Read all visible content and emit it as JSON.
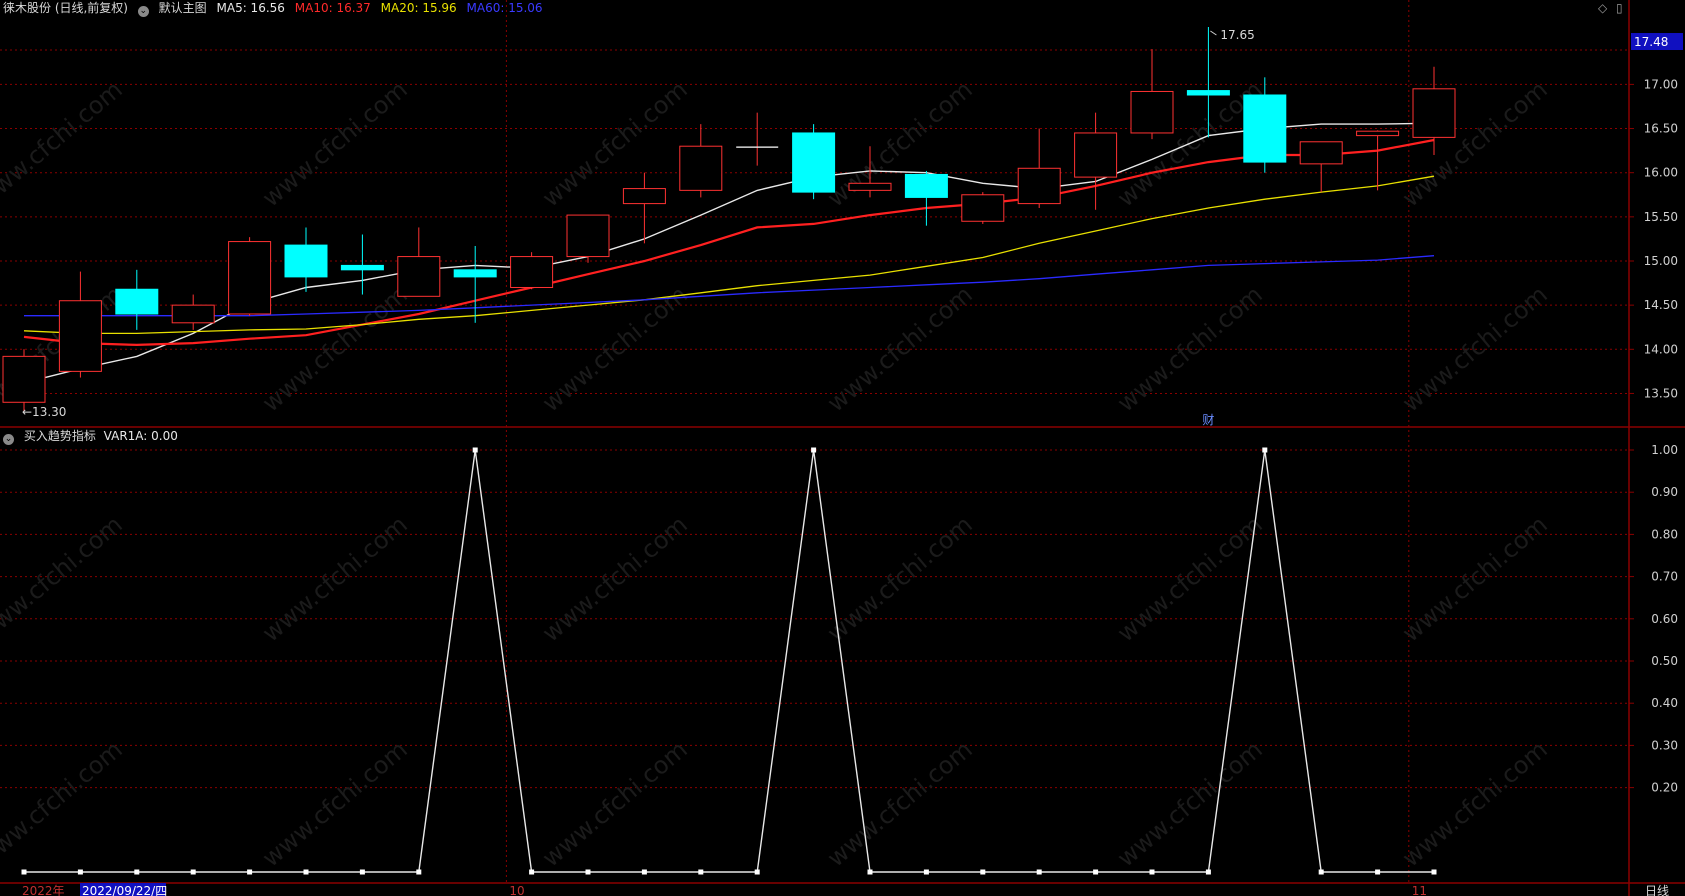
{
  "header": {
    "stock_title": "徕木股份 (日线,前复权)",
    "main_chart_label": "默认主图",
    "ma5_label": "MA5: 16.56",
    "ma10_label": "MA10: 16.37",
    "ma20_label": "MA20: 15.96",
    "ma60_label": "MA60: 15.06"
  },
  "indicator_header": {
    "title": "买入趋势指标",
    "var_label": "VAR1A: 0.00"
  },
  "colors": {
    "background": "#000000",
    "up": "#ff3232",
    "down": "#00ffff",
    "ma5": "#e8e8e8",
    "ma10": "#ff2020",
    "ma20": "#e8e000",
    "ma60": "#2a2aff",
    "grid": "#8a0000",
    "axis_text": "#d0d0d0",
    "price_tag_bg": "#1010c0"
  },
  "icons": {
    "settings": "circle-chevron-icon",
    "diamond": "diamond-icon",
    "window": "window-icon"
  },
  "watermark": "www.cfchi.com",
  "main_axis": {
    "labels": [
      "17.00",
      "16.50",
      "16.00",
      "15.50",
      "15.00",
      "14.50",
      "14.00",
      "13.50"
    ],
    "current_price_tag": "17.48"
  },
  "indicator_axis": {
    "labels": [
      "1.00",
      "0.90",
      "0.80",
      "0.70",
      "0.60",
      "0.50",
      "0.40",
      "0.30",
      "0.20"
    ]
  },
  "annotations": {
    "high": "17.65",
    "low": "13.30",
    "finance_marker": "财"
  },
  "date_axis": {
    "year_label": "2022年",
    "cursor_date": "2022/09/22/四",
    "month_10": "10",
    "month_11": "11",
    "period_button": "日线"
  },
  "chart_data": [
    {
      "type": "candlestick",
      "ylim": [
        13.2,
        17.65
      ],
      "candles": [
        {
          "o": 13.4,
          "h": 14.0,
          "l": 13.3,
          "c": 13.92
        },
        {
          "o": 13.75,
          "h": 14.88,
          "l": 13.68,
          "c": 14.55
        },
        {
          "o": 14.68,
          "h": 14.9,
          "l": 14.22,
          "c": 14.4
        },
        {
          "o": 14.3,
          "h": 14.62,
          "l": 14.22,
          "c": 14.5
        },
        {
          "o": 14.4,
          "h": 15.27,
          "l": 14.38,
          "c": 15.22
        },
        {
          "o": 15.18,
          "h": 15.38,
          "l": 14.65,
          "c": 14.82
        },
        {
          "o": 14.95,
          "h": 15.3,
          "l": 14.62,
          "c": 14.9
        },
        {
          "o": 14.6,
          "h": 15.38,
          "l": 14.6,
          "c": 15.05
        },
        {
          "o": 14.9,
          "h": 15.17,
          "l": 14.3,
          "c": 14.82
        },
        {
          "o": 14.7,
          "h": 15.1,
          "l": 14.68,
          "c": 15.05
        },
        {
          "o": 15.05,
          "h": 15.52,
          "l": 14.98,
          "c": 15.52
        },
        {
          "o": 15.65,
          "h": 16.0,
          "l": 15.2,
          "c": 15.82
        },
        {
          "o": 15.8,
          "h": 16.55,
          "l": 15.72,
          "c": 16.3
        },
        {
          "o": 16.29,
          "h": 16.68,
          "l": 16.08,
          "c": 16.29
        },
        {
          "o": 16.45,
          "h": 16.55,
          "l": 15.7,
          "c": 15.78
        },
        {
          "o": 15.8,
          "h": 16.3,
          "l": 15.72,
          "c": 15.88
        },
        {
          "o": 15.98,
          "h": 16.02,
          "l": 15.4,
          "c": 15.72
        },
        {
          "o": 15.45,
          "h": 15.78,
          "l": 15.42,
          "c": 15.75
        },
        {
          "o": 15.65,
          "h": 16.5,
          "l": 15.6,
          "c": 16.05
        },
        {
          "o": 15.95,
          "h": 16.68,
          "l": 15.58,
          "c": 16.45
        },
        {
          "o": 16.45,
          "h": 17.4,
          "l": 16.38,
          "c": 16.92
        },
        {
          "o": 16.93,
          "h": 17.65,
          "l": 16.4,
          "c": 16.88
        },
        {
          "o": 16.88,
          "h": 17.08,
          "l": 16.0,
          "c": 16.12
        },
        {
          "o": 16.1,
          "h": 16.35,
          "l": 15.78,
          "c": 16.35
        },
        {
          "o": 16.42,
          "h": 16.48,
          "l": 15.8,
          "c": 16.47
        },
        {
          "o": 16.4,
          "h": 17.2,
          "l": 16.2,
          "c": 16.95
        }
      ],
      "series": [
        {
          "name": "MA5",
          "values": [
            13.62,
            13.78,
            13.92,
            14.18,
            14.52,
            14.7,
            14.78,
            14.9,
            14.95,
            14.92,
            15.05,
            15.25,
            15.52,
            15.8,
            15.95,
            16.02,
            16.0,
            15.88,
            15.82,
            15.9,
            16.15,
            16.42,
            16.5,
            16.55,
            16.55,
            16.56
          ]
        },
        {
          "name": "MA10",
          "values": [
            14.14,
            14.07,
            14.05,
            14.07,
            14.12,
            14.16,
            14.28,
            14.4,
            14.55,
            14.7,
            14.85,
            15.0,
            15.18,
            15.38,
            15.42,
            15.52,
            15.6,
            15.65,
            15.72,
            15.85,
            16.0,
            16.12,
            16.2,
            16.2,
            16.25,
            16.37
          ]
        },
        {
          "name": "MA20",
          "values": [
            14.21,
            14.18,
            14.18,
            14.2,
            14.22,
            14.23,
            14.28,
            14.34,
            14.38,
            14.44,
            14.5,
            14.56,
            14.64,
            14.72,
            14.78,
            14.84,
            14.94,
            15.04,
            15.2,
            15.34,
            15.48,
            15.6,
            15.7,
            15.78,
            15.85,
            15.96
          ]
        },
        {
          "name": "MA60",
          "values": [
            14.38,
            14.38,
            14.38,
            14.38,
            14.38,
            14.4,
            14.42,
            14.44,
            14.47,
            14.5,
            14.53,
            14.56,
            14.6,
            14.64,
            14.67,
            14.7,
            14.73,
            14.76,
            14.8,
            14.85,
            14.9,
            14.95,
            14.97,
            14.99,
            15.01,
            15.06
          ]
        }
      ]
    },
    {
      "type": "line",
      "name": "VAR1A",
      "ylim": [
        0,
        1
      ],
      "values": [
        0,
        0,
        0,
        0,
        0,
        0,
        0,
        0,
        1,
        0,
        0,
        0,
        0,
        0,
        1,
        0,
        0,
        0,
        0,
        0,
        0,
        0,
        1,
        0,
        0,
        0
      ]
    }
  ]
}
